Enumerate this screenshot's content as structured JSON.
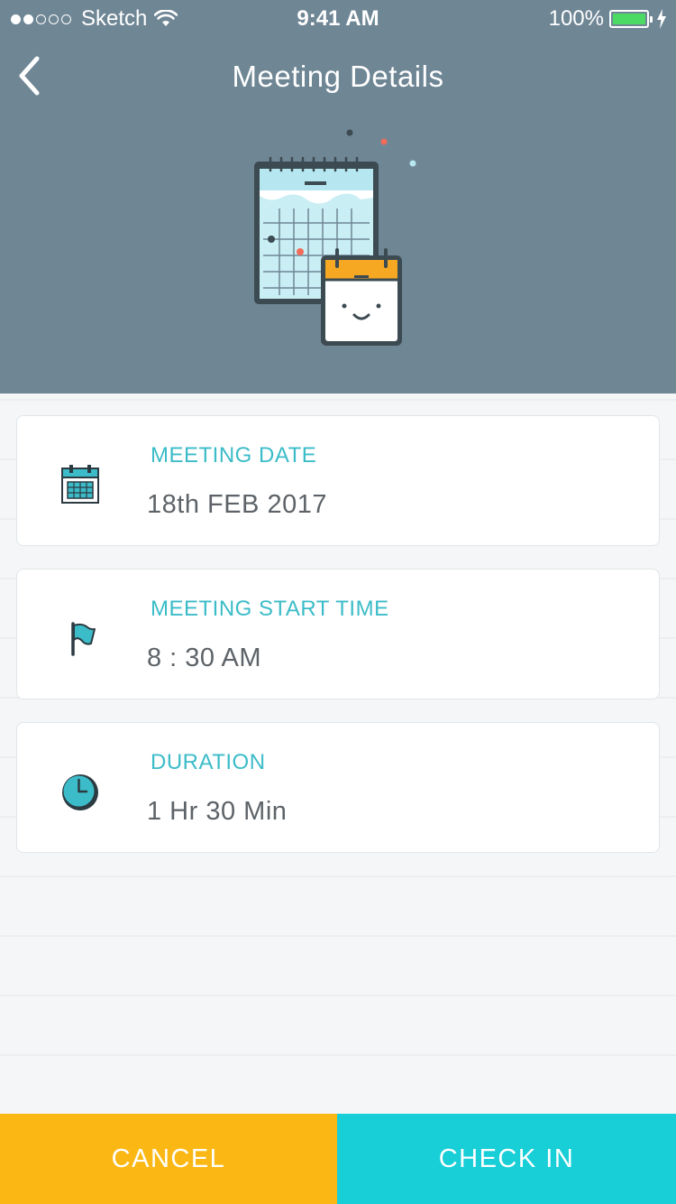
{
  "status_bar": {
    "carrier": "Sketch",
    "time": "9:41 AM",
    "battery": "100%",
    "signal_bars_full": 2,
    "signal_bars_total": 5,
    "wifi_icon": "wifi-icon",
    "charge_icon": "bolt-icon"
  },
  "nav": {
    "title": "Meeting Details",
    "back_icon": "chevron-left-icon"
  },
  "colors": {
    "header_bg": "#6f8695",
    "accent_teal": "#3bbcc8",
    "cancel_bg": "#fbb815",
    "checkin_bg": "#18ced7",
    "value_text": "#5d6368"
  },
  "details": [
    {
      "label": "MEETING DATE",
      "value": "18th FEB 2017",
      "icon": "calendar-icon"
    },
    {
      "label": "MEETING START TIME",
      "value": "8 : 30 AM",
      "icon": "flag-icon"
    },
    {
      "label": "DURATION",
      "value": "1 Hr 30 Min",
      "icon": "clock-icon"
    }
  ],
  "actions": {
    "cancel_label": "CANCEL",
    "checkin_label": "CHECK IN"
  }
}
